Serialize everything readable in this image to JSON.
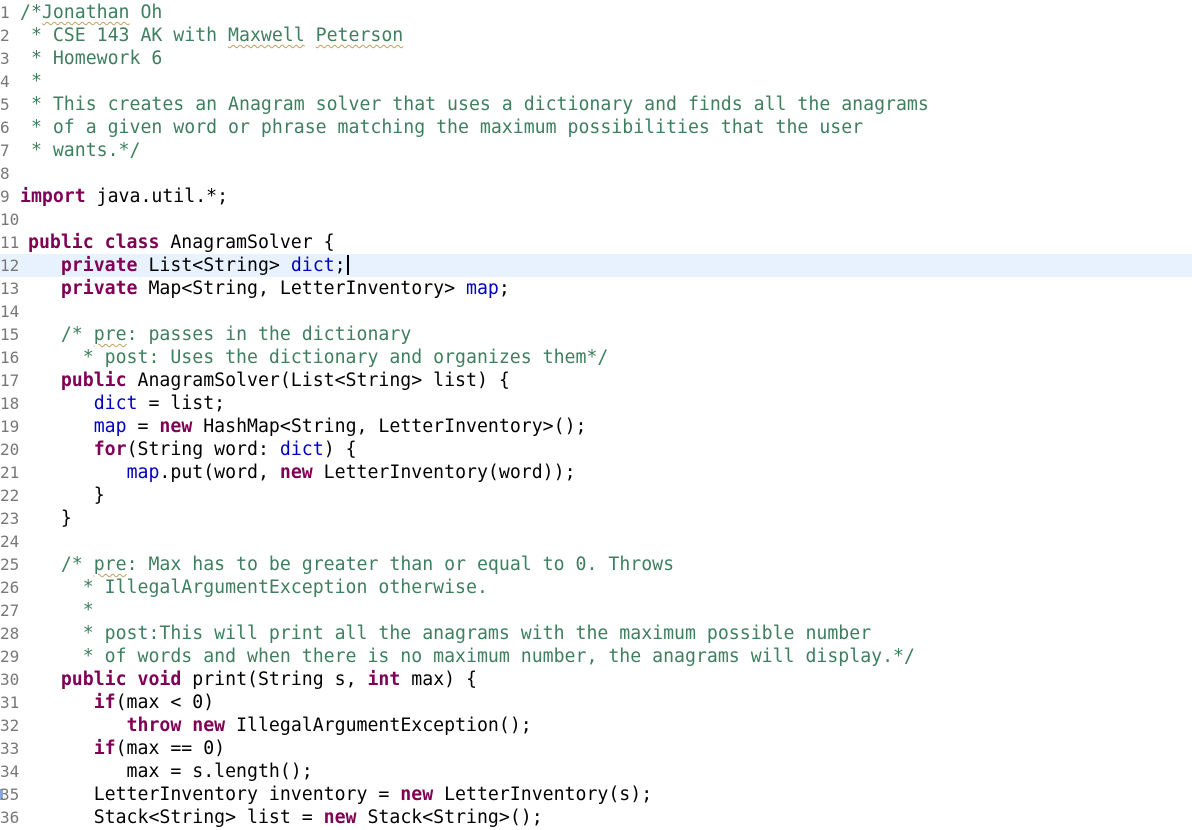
{
  "editor": {
    "file_class": "AnagramSolver",
    "lines": [
      {
        "n": "1",
        "tokens": [
          [
            "cm",
            "/*Jonathan Oh"
          ]
        ]
      },
      {
        "n": "2",
        "tokens": [
          [
            "cm",
            " * CSE 143 AK with Maxwell Peterson"
          ]
        ]
      },
      {
        "n": "3",
        "tokens": [
          [
            "cm",
            " * Homework 6"
          ]
        ]
      },
      {
        "n": "4",
        "tokens": [
          [
            "cm",
            " *"
          ]
        ]
      },
      {
        "n": "5",
        "tokens": [
          [
            "cm",
            " * This creates an Anagram solver that uses a dictionary and finds all the anagrams"
          ]
        ]
      },
      {
        "n": "6",
        "tokens": [
          [
            "cm",
            " * of a given word or phrase matching the maximum possibilities that the user"
          ]
        ]
      },
      {
        "n": "7",
        "tokens": [
          [
            "cm",
            " * wants.*/"
          ]
        ]
      },
      {
        "n": "8",
        "tokens": []
      },
      {
        "n": "9",
        "tokens": [
          [
            "kw",
            "import"
          ],
          [
            "pl",
            " java.util.*;"
          ]
        ]
      },
      {
        "n": "10",
        "tokens": []
      },
      {
        "n": "11",
        "tokens": [
          [
            "kw",
            "public"
          ],
          [
            "pl",
            " "
          ],
          [
            "kw",
            "class"
          ],
          [
            "pl",
            " AnagramSolver {"
          ]
        ]
      },
      {
        "n": "12",
        "current": true,
        "tokens": [
          [
            "pl",
            "   "
          ],
          [
            "kw",
            "private"
          ],
          [
            "pl",
            " List<String> "
          ],
          [
            "fld",
            "dict"
          ],
          [
            "pl",
            ";"
          ]
        ]
      },
      {
        "n": "13",
        "tokens": [
          [
            "pl",
            "   "
          ],
          [
            "kw",
            "private"
          ],
          [
            "pl",
            " Map<String, LetterInventory> "
          ],
          [
            "fld",
            "map"
          ],
          [
            "pl",
            ";"
          ]
        ]
      },
      {
        "n": "14",
        "tokens": []
      },
      {
        "n": "15",
        "tokens": [
          [
            "pl",
            "   "
          ],
          [
            "cm",
            "/* "
          ],
          [
            "cm-sp",
            "pre"
          ],
          [
            "cm",
            ": passes in the dictionary"
          ]
        ]
      },
      {
        "n": "16",
        "tokens": [
          [
            "pl",
            "   "
          ],
          [
            "cm",
            "  * post: Uses the dictionary and organizes them*/"
          ]
        ]
      },
      {
        "n": "17",
        "tokens": [
          [
            "pl",
            "   "
          ],
          [
            "kw",
            "public"
          ],
          [
            "pl",
            " AnagramSolver(List<String> list) {"
          ]
        ]
      },
      {
        "n": "18",
        "tokens": [
          [
            "pl",
            "      "
          ],
          [
            "fld",
            "dict"
          ],
          [
            "pl",
            " = list;"
          ]
        ]
      },
      {
        "n": "19",
        "tokens": [
          [
            "pl",
            "      "
          ],
          [
            "fld",
            "map"
          ],
          [
            "pl",
            " = "
          ],
          [
            "kw",
            "new"
          ],
          [
            "pl",
            " HashMap<String, LetterInventory>();"
          ]
        ]
      },
      {
        "n": "20",
        "tokens": [
          [
            "pl",
            "      "
          ],
          [
            "kw",
            "for"
          ],
          [
            "pl",
            "(String word: "
          ],
          [
            "fld",
            "dict"
          ],
          [
            "pl",
            ") {"
          ]
        ]
      },
      {
        "n": "21",
        "tokens": [
          [
            "pl",
            "         "
          ],
          [
            "fld",
            "map"
          ],
          [
            "pl",
            ".put(word, "
          ],
          [
            "kw",
            "new"
          ],
          [
            "pl",
            " LetterInventory(word));"
          ]
        ]
      },
      {
        "n": "22",
        "tokens": [
          [
            "pl",
            "      }"
          ]
        ]
      },
      {
        "n": "23",
        "tokens": [
          [
            "pl",
            "   }"
          ]
        ]
      },
      {
        "n": "24",
        "tokens": []
      },
      {
        "n": "25",
        "tokens": [
          [
            "pl",
            "   "
          ],
          [
            "cm",
            "/* "
          ],
          [
            "cm-sp",
            "pre"
          ],
          [
            "cm",
            ": Max has to be greater than or equal to 0. Throws"
          ]
        ]
      },
      {
        "n": "26",
        "tokens": [
          [
            "pl",
            "   "
          ],
          [
            "cm",
            "  * IllegalArgumentException otherwise."
          ]
        ]
      },
      {
        "n": "27",
        "tokens": [
          [
            "pl",
            "   "
          ],
          [
            "cm",
            "  *"
          ]
        ]
      },
      {
        "n": "28",
        "tokens": [
          [
            "pl",
            "   "
          ],
          [
            "cm",
            "  * post:This will print all the anagrams with the maximum possible number"
          ]
        ]
      },
      {
        "n": "29",
        "tokens": [
          [
            "pl",
            "   "
          ],
          [
            "cm",
            "  * of words and when there is no maximum number, the anagrams will display.*/"
          ]
        ]
      },
      {
        "n": "30",
        "tokens": [
          [
            "pl",
            "   "
          ],
          [
            "kw",
            "public"
          ],
          [
            "pl",
            " "
          ],
          [
            "kw",
            "void"
          ],
          [
            "pl",
            " print(String s, "
          ],
          [
            "kw",
            "int"
          ],
          [
            "pl",
            " max) {"
          ]
        ]
      },
      {
        "n": "31",
        "tokens": [
          [
            "pl",
            "      "
          ],
          [
            "kw",
            "if"
          ],
          [
            "pl",
            "(max < 0)"
          ]
        ]
      },
      {
        "n": "32",
        "tokens": [
          [
            "pl",
            "         "
          ],
          [
            "kw",
            "throw"
          ],
          [
            "pl",
            " "
          ],
          [
            "kw",
            "new"
          ],
          [
            "pl",
            " IllegalArgumentException();"
          ]
        ]
      },
      {
        "n": "33",
        "tokens": [
          [
            "pl",
            "      "
          ],
          [
            "kw",
            "if"
          ],
          [
            "pl",
            "(max == 0)"
          ]
        ]
      },
      {
        "n": "34",
        "tokens": [
          [
            "pl",
            "         max = s.length();"
          ]
        ]
      },
      {
        "n": "35",
        "marker": true,
        "tokens": [
          [
            "pl",
            "      LetterInventory inventory = "
          ],
          [
            "kw",
            "new"
          ],
          [
            "pl",
            " LetterInventory(s);"
          ]
        ]
      },
      {
        "n": "36",
        "tokens": [
          [
            "pl",
            "      Stack<String> list = "
          ],
          [
            "kw",
            "new"
          ],
          [
            "pl",
            " Stack<String>();"
          ]
        ]
      }
    ]
  },
  "spellcheck_words": [
    "Jonathan",
    "Maxwell",
    "Peterson"
  ],
  "colors": {
    "keyword": "#7f0055",
    "comment": "#3f7f5f",
    "field": "#0000c0",
    "plain": "#000000",
    "line_number": "#787878",
    "current_line": "#e8f2fe"
  }
}
